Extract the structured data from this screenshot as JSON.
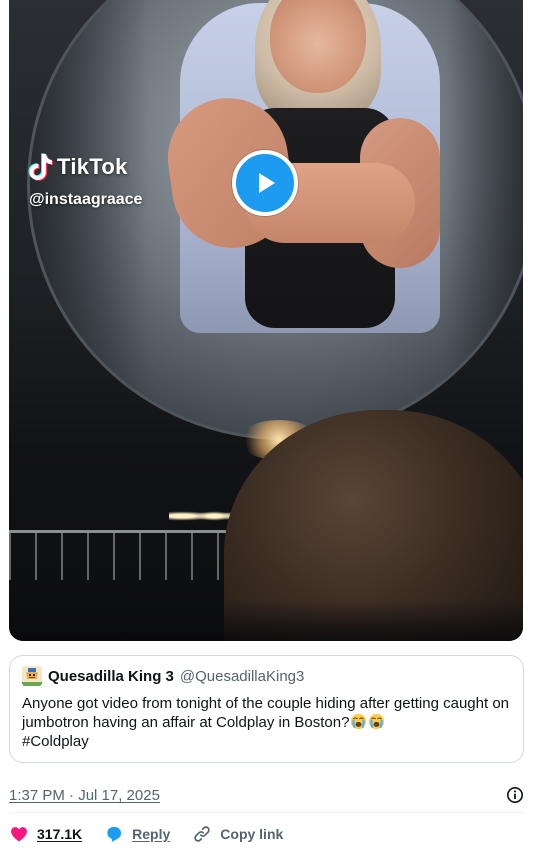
{
  "media": {
    "watermark": {
      "brand": "TikTok",
      "handle": "@instaagraace",
      "icon": "tiktok-logo-icon"
    },
    "play_icon": "play-icon",
    "accent_color": "#1d9bf0"
  },
  "quoted_tweet": {
    "avatar_icon": "avatar-icon",
    "display_name": "Quesadilla King 3",
    "handle": "@QuesadillaKing3",
    "text": "Anyone got video from tonight of the couple hiding after getting caught on jumbotron having an affair at Coldplay in Boston?",
    "emojis": [
      "loudly-crying-face-icon",
      "loudly-crying-face-icon"
    ],
    "hashtag": "#Coldplay"
  },
  "meta": {
    "timestamp": "1:37 PM · Jul 17, 2025",
    "info_icon": "info-icon"
  },
  "actions": {
    "likes": {
      "label": "317.1K",
      "icon": "heart-icon",
      "color": "#f91880"
    },
    "reply": {
      "label": "Reply",
      "icon": "reply-bubble-icon",
      "color": "#1d9bf0"
    },
    "copy_link": {
      "label": "Copy link",
      "icon": "link-icon",
      "color": "#536471"
    }
  }
}
